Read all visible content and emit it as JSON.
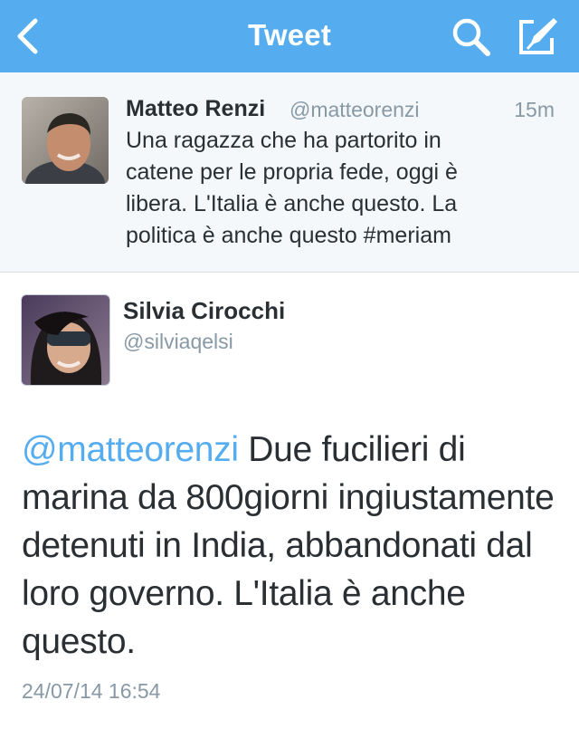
{
  "colors": {
    "navbar": "#55acee",
    "mention": "#55acee",
    "meta_text": "#8899a6",
    "body_text": "#292f33"
  },
  "navbar": {
    "title": "Tweet",
    "back_icon": "chevron-left-icon",
    "search_icon": "search-icon",
    "compose_icon": "compose-icon"
  },
  "parent_tweet": {
    "author_name": "Matteo Renzi",
    "author_handle": "@matteorenzi",
    "time": "15m",
    "text": "Una ragazza che ha partorito in\ncatene per le propria fede, oggi è\nlibera. L'Italia è anche questo. La\npolitica è anche questo #meriam"
  },
  "main_tweet": {
    "author_name": "Silvia Cirocchi",
    "author_handle": "@silviaqelsi",
    "mention": "@matteorenzi",
    "text": " Due fucilieri di marina da 800giorni ingiustamente detenuti in India, abbandonati dal loro governo. L'Italia è anche questo.",
    "timestamp": "24/07/14 16:54"
  }
}
